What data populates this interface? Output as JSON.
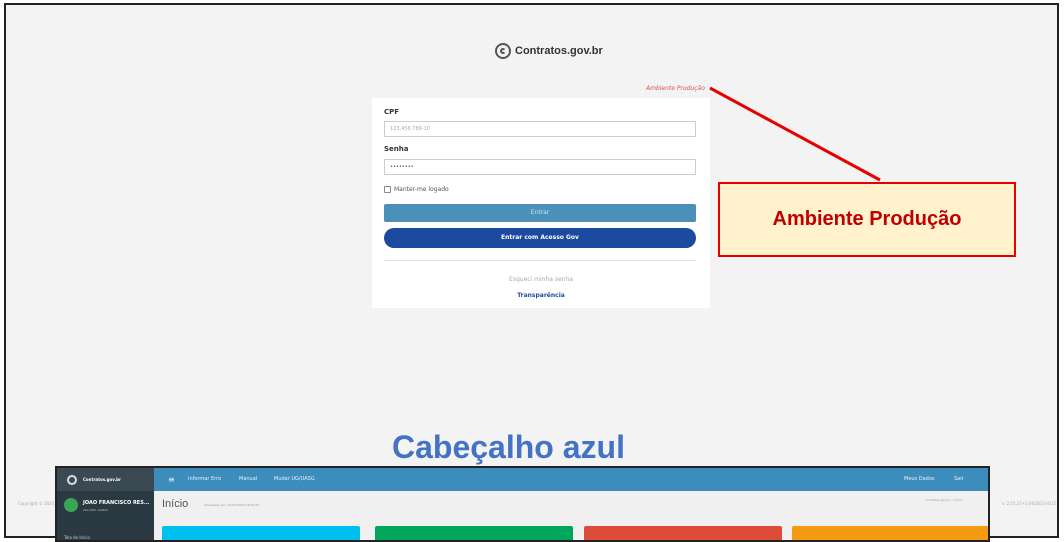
{
  "login": {
    "logo_text": "Contratos.gov.br",
    "environment_label": "Ambiente Produção",
    "cpf_label": "CPF",
    "cpf_placeholder": "123.456.789-10",
    "password_label": "Senha",
    "password_value": "••••••••",
    "remember_label": "Manter-me logado",
    "enter_button": "Entrar",
    "gov_button": "Entrar com Acesso Gov",
    "forgot_link": "Esqueci minha senha",
    "transparency_link": "Transparência"
  },
  "annotations": {
    "environment_callout": "Ambiente Produção",
    "header_caption": "Cabeçalho azul"
  },
  "footer": {
    "copyright_left": "Copyright © 2023",
    "version_right": "v. 2.55.27+2.00/2023-8/15"
  },
  "dashboard": {
    "sidebar_logo": "Contratos.gov.br",
    "user_name": "JOAO FRANCISCO RES...",
    "user_role": "202-900: AGBAS",
    "nav_first": "Tela de Início",
    "header_items": {
      "inform_errors": "Informar Erro",
      "manual": "Manual",
      "change_ug": "Mudar UG/UASG",
      "my_data": "Meus Dados",
      "logout": "Sair"
    },
    "page_title": "Início",
    "page_subtitle": "Atualizado em: 15/05/2023 19:55:05",
    "breadcrumb": "Contratos.gov.br > Início"
  },
  "colors": {
    "header_blue": "#3c8dbc",
    "gov_blue": "#1c4a9e",
    "callout_red": "#e60000",
    "callout_fill": "#fff2cc",
    "caption_blue": "#4472c4",
    "tiles": [
      "#00c0ef",
      "#00a65a",
      "#dd4b39",
      "#f39c12"
    ]
  }
}
